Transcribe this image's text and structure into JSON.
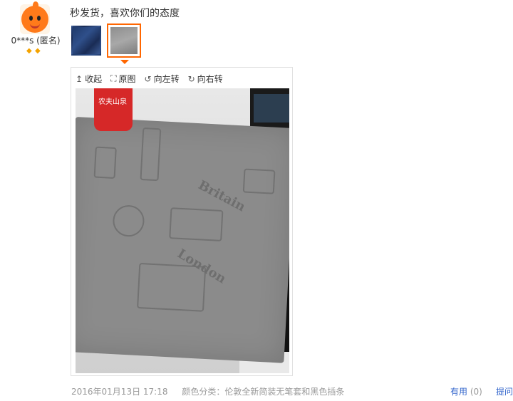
{
  "review": {
    "username": "0***s (匿名)",
    "comment": "秒发货，喜欢你们的态度",
    "toolbar": {
      "collapse": "收起",
      "original": "原图",
      "rotate_left": "向左转",
      "rotate_right": "向右转"
    },
    "date": "2016年01月13日 17:18",
    "sku": "颜色分类：伦敦全新简装无笔套和黑色插条",
    "useful_label": "有用",
    "useful_count": "(0)",
    "reply_label": "提问"
  },
  "colors": {
    "accent": "#ff6600",
    "link": "#3366cc",
    "muted": "#999999"
  },
  "icons": [
    "avatar-mascot",
    "diamond-icon",
    "collapse-icon",
    "fullscreen-icon",
    "rotate-left-icon",
    "rotate-right-icon"
  ]
}
